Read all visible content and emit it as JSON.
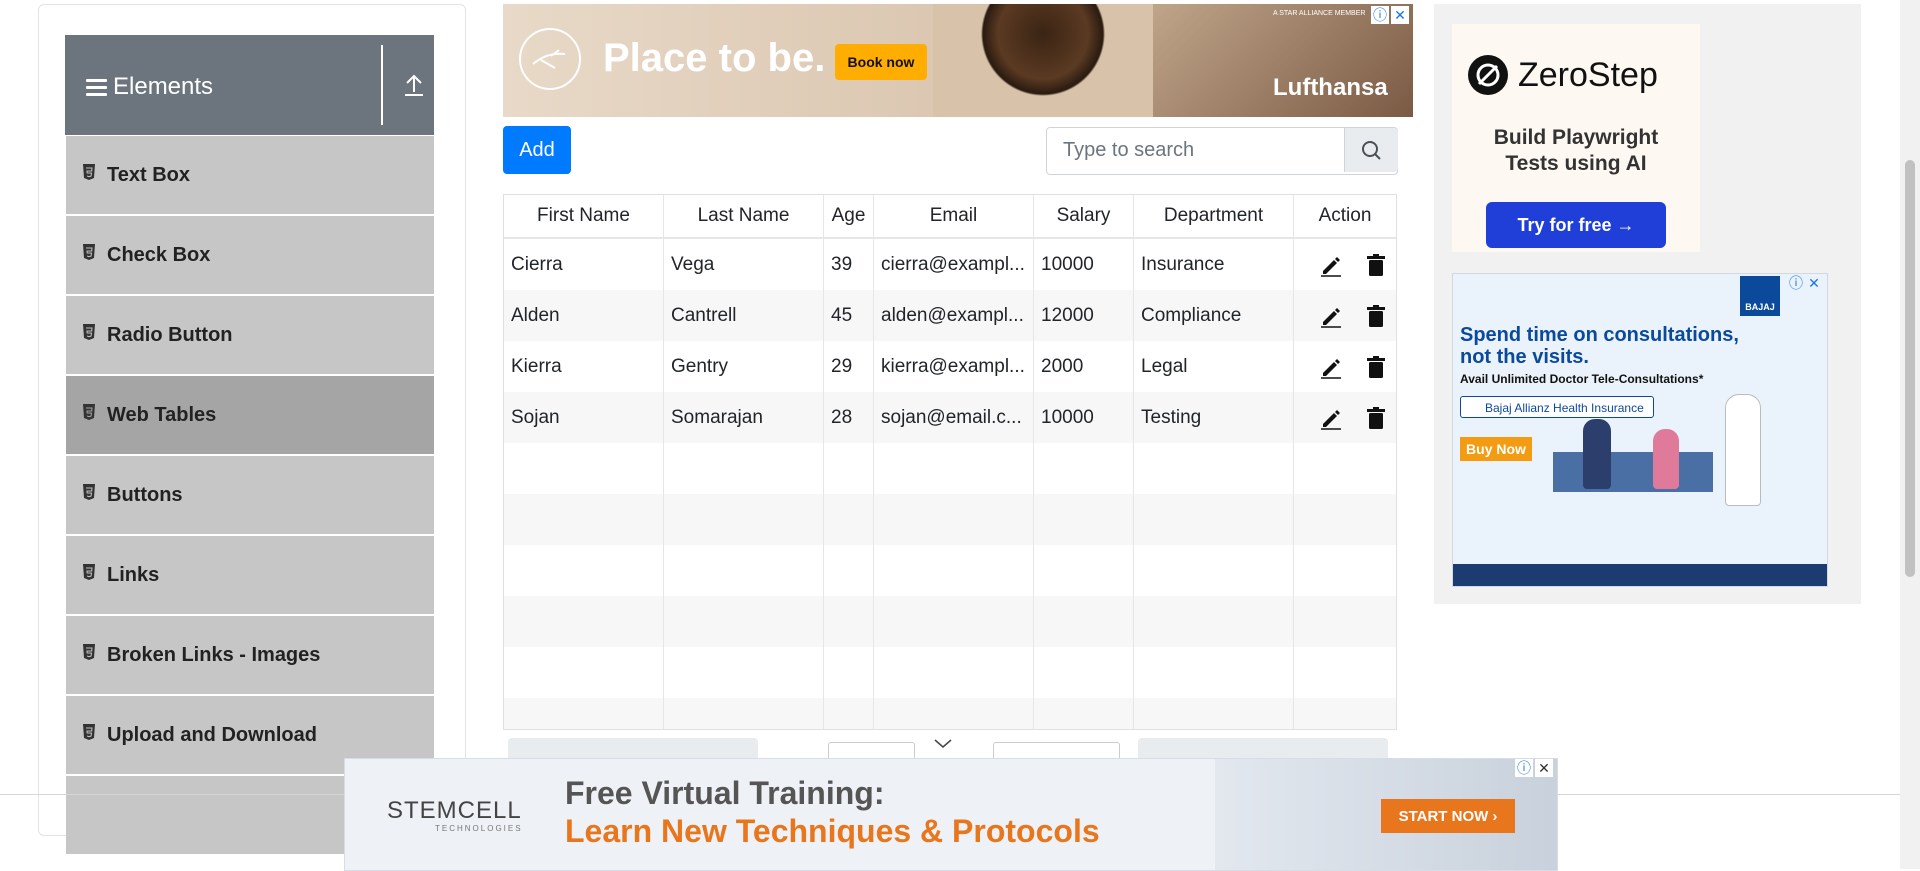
{
  "sidebar": {
    "group_title": "Elements",
    "items": [
      {
        "label": "Text Box"
      },
      {
        "label": "Check Box"
      },
      {
        "label": "Radio Button"
      },
      {
        "label": "Web Tables",
        "active": true
      },
      {
        "label": "Buttons"
      },
      {
        "label": "Links"
      },
      {
        "label": "Broken Links - Images"
      },
      {
        "label": "Upload and Download"
      }
    ]
  },
  "top_ad": {
    "headline": "Place to be.",
    "cta": "Book now",
    "brand": "Lufthansa",
    "small_text": "A STAR ALLIANCE MEMBER"
  },
  "toolbar": {
    "add_label": "Add",
    "search_placeholder": "Type to search"
  },
  "table": {
    "columns": [
      "First Name",
      "Last Name",
      "Age",
      "Email",
      "Salary",
      "Department",
      "Action"
    ],
    "rows": [
      {
        "first": "Cierra",
        "last": "Vega",
        "age": "39",
        "email": "cierra@exampl...",
        "salary": "10000",
        "department": "Insurance"
      },
      {
        "first": "Alden",
        "last": "Cantrell",
        "age": "45",
        "email": "alden@exampl...",
        "salary": "12000",
        "department": "Compliance"
      },
      {
        "first": "Kierra",
        "last": "Gentry",
        "age": "29",
        "email": "kierra@exampl...",
        "salary": "2000",
        "department": "Legal"
      },
      {
        "first": "Sojan",
        "last": "Somarajan",
        "age": "28",
        "email": "sojan@email.c...",
        "salary": "10000",
        "department": "Testing"
      }
    ]
  },
  "zerostep_ad": {
    "brand": "ZeroStep",
    "line1": "Build Playwright",
    "line2": "Tests using AI",
    "cta": "Try for free →"
  },
  "bajaj_ad": {
    "headline1": "Spend time on consultations,",
    "headline2": "not the visits.",
    "sub": "Avail Unlimited Doctor Tele-Consultations*",
    "search_text": "Bajaj Allianz Health Insurance",
    "cta": "Buy Now",
    "logo": "BAJAJ"
  },
  "bottom_ad": {
    "brand": "STEMCELL",
    "brand_sub": "TECHNOLOGIES",
    "headline1": "Free Virtual Training:",
    "headline2": "Learn New Techniques & Protocols",
    "cta": "START NOW ›"
  },
  "colors": {
    "primary": "#007bff",
    "sidebar_header": "#6c757d",
    "menu_bg": "#c6c6c6",
    "menu_active": "#a5a5a5",
    "bottom_ad_orange": "#e8761d",
    "zerostep_blue": "#1f3fd8"
  }
}
